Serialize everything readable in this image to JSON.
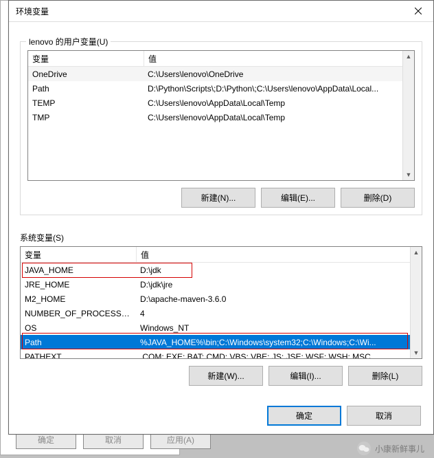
{
  "window": {
    "title": "环境变量"
  },
  "user_vars": {
    "group_label": "lenovo 的用户变量(U)",
    "header_var": "变量",
    "header_val": "值",
    "rows": [
      {
        "name": "OneDrive",
        "value": "C:\\Users\\lenovo\\OneDrive"
      },
      {
        "name": "Path",
        "value": "D:\\Python\\Scripts\\;D:\\Python\\;C:\\Users\\lenovo\\AppData\\Local..."
      },
      {
        "name": "TEMP",
        "value": "C:\\Users\\lenovo\\AppData\\Local\\Temp"
      },
      {
        "name": "TMP",
        "value": "C:\\Users\\lenovo\\AppData\\Local\\Temp"
      }
    ],
    "btn_new": "新建(N)...",
    "btn_edit": "编辑(E)...",
    "btn_del": "删除(D)"
  },
  "sys_vars": {
    "label": "系统变量(S)",
    "header_var": "变量",
    "header_val": "值",
    "rows": [
      {
        "name": "JAVA_HOME",
        "value": "D:\\jdk"
      },
      {
        "name": "JRE_HOME",
        "value": "D:\\jdk\\jre"
      },
      {
        "name": "M2_HOME",
        "value": "D:\\apache-maven-3.6.0"
      },
      {
        "name": "NUMBER_OF_PROCESSORS",
        "value": "4"
      },
      {
        "name": "OS",
        "value": "Windows_NT"
      },
      {
        "name": "Path",
        "value": "%JAVA_HOME%\\bin;C:\\Windows\\system32;C:\\Windows;C:\\Wi..."
      },
      {
        "name": "PATHEXT",
        "value": ".COM;.EXE;.BAT;.CMD;.VBS;.VBE;.JS;.JSE;.WSF;.WSH;.MSC"
      }
    ],
    "btn_new": "新建(W)...",
    "btn_edit": "编辑(I)...",
    "btn_del": "删除(L)"
  },
  "footer": {
    "ok": "确定",
    "cancel": "取消"
  },
  "behind": {
    "ok": "确定",
    "cancel": "取消",
    "apply": "应用(A)"
  },
  "watermark": "小康新鲜事儿"
}
